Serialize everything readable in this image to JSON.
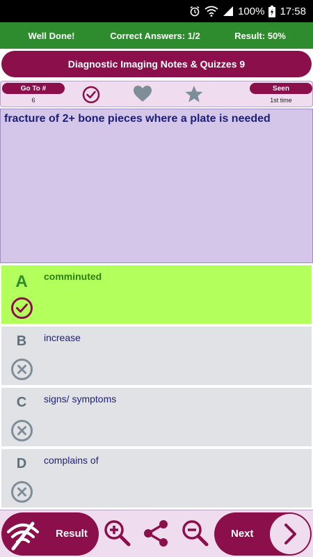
{
  "status_bar": {
    "battery": "100%",
    "time": "17:58",
    "icons": [
      "alarm-icon",
      "wifi-icon",
      "signal-icon",
      "battery-icon"
    ]
  },
  "score_bar": {
    "message": "Well Done!",
    "correct": "Correct Answers: 1/2",
    "result": "Result: 50%"
  },
  "title": "Diagnostic Imaging Notes & Quizzes 9",
  "toolbar": {
    "goto_label": "Go To #",
    "goto_value": "6",
    "seen_label": "Seen",
    "seen_value": "1st time",
    "icons": [
      "check-circle-icon",
      "heart-icon",
      "star-icon"
    ]
  },
  "question": "fracture of 2+ bone pieces where a plate is needed",
  "answers": [
    {
      "letter": "A",
      "text": "comminuted",
      "status": "correct"
    },
    {
      "letter": "B",
      "text": "increase",
      "status": "wrong"
    },
    {
      "letter": "C",
      "text": "signs/ symptoms",
      "status": "wrong"
    },
    {
      "letter": "D",
      "text": "complains of",
      "status": "wrong"
    }
  ],
  "bottom_bar": {
    "result_label": "Result",
    "next_label": "Next",
    "icons": [
      "zoom-in-icon",
      "share-icon",
      "zoom-out-icon",
      "chevron-right-icon"
    ]
  },
  "colors": {
    "primary": "#8b0f4b",
    "score_bar": "#2e8b2e",
    "correct_answer": "#b3ff5c",
    "question_bg": "#d3c6e8",
    "answer_bg": "#e1e2e6",
    "text_navy": "#1c1e7a"
  }
}
